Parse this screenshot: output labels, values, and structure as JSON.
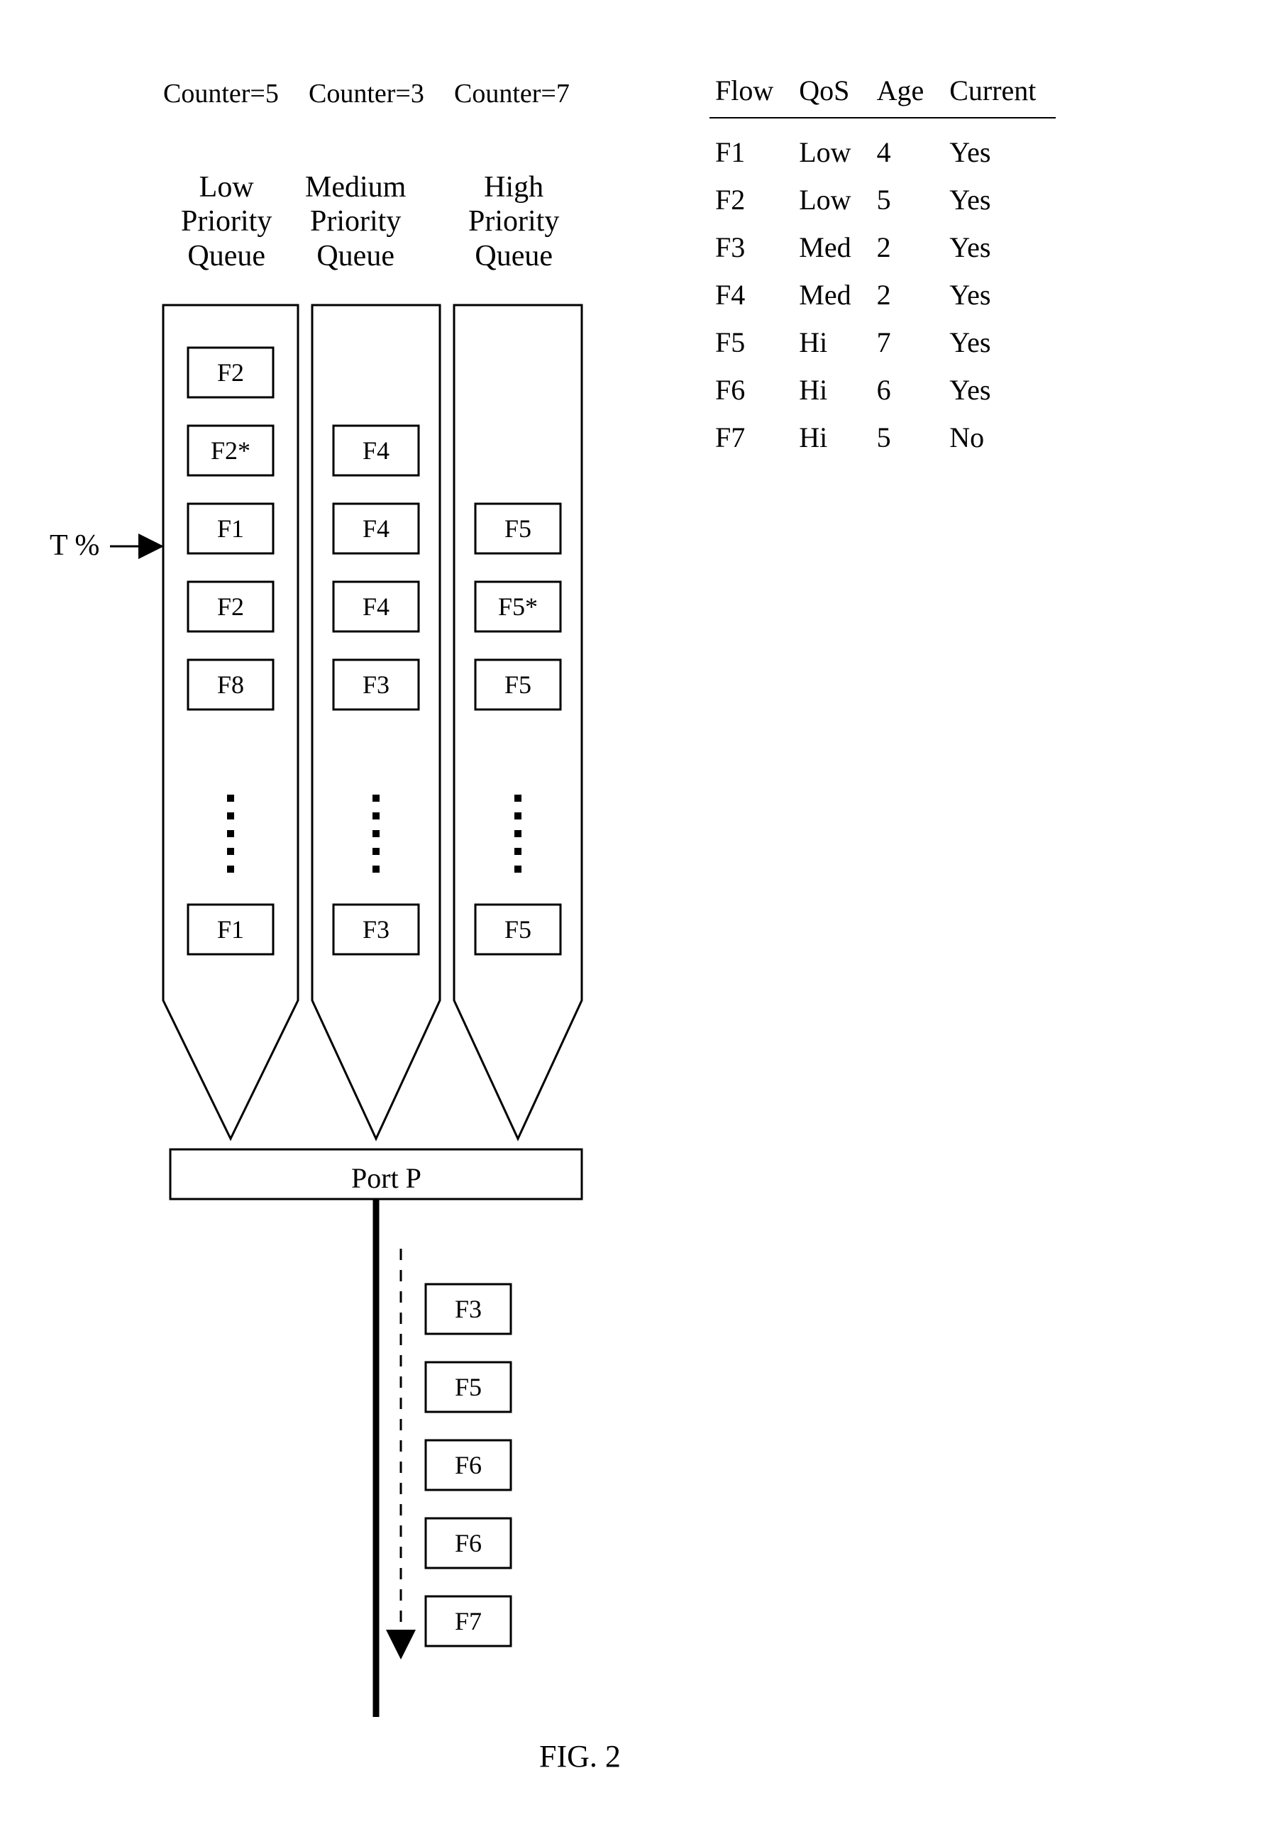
{
  "counters": {
    "low": "Counter=5",
    "med": "Counter=3",
    "high": "Counter=7"
  },
  "queue_titles": {
    "low": {
      "l1": "Low",
      "l2": "Priority",
      "l3": "Queue"
    },
    "med": {
      "l1": "Medium",
      "l2": "Priority",
      "l3": "Queue"
    },
    "high": {
      "l1": "High",
      "l2": "Priority",
      "l3": "Queue"
    }
  },
  "t_label": "T %",
  "port_label": "Port P",
  "fig_label": "FIG. 2",
  "queues": {
    "low": [
      "F2",
      "F2*",
      "F1",
      "F2",
      "F8"
    ],
    "med": [
      "",
      "F4",
      "F4",
      "F4",
      "F3"
    ],
    "high": [
      "",
      "",
      "F5",
      "F5*",
      "F5"
    ]
  },
  "queue_bottom": {
    "low": "F1",
    "med": "F3",
    "high": "F5"
  },
  "output": [
    "F3",
    "F5",
    "F6",
    "F6",
    "F7"
  ],
  "table": {
    "headers": [
      "Flow",
      "QoS",
      "Age",
      "Current"
    ],
    "rows": [
      {
        "flow": "F1",
        "qos": "Low",
        "age": "4",
        "current": "Yes"
      },
      {
        "flow": "F2",
        "qos": "Low",
        "age": "5",
        "current": "Yes"
      },
      {
        "flow": "F3",
        "qos": "Med",
        "age": "2",
        "current": "Yes"
      },
      {
        "flow": "F4",
        "qos": "Med",
        "age": "2",
        "current": "Yes"
      },
      {
        "flow": "F5",
        "qos": "Hi",
        "age": "7",
        "current": "Yes"
      },
      {
        "flow": "F6",
        "qos": "Hi",
        "age": "6",
        "current": "Yes"
      },
      {
        "flow": "F7",
        "qos": "Hi",
        "age": "5",
        "current": "No"
      }
    ]
  },
  "chart_data": {
    "type": "table",
    "title": "Priority queues with flow table and output port sequence",
    "counters": {
      "low": 5,
      "medium": 3,
      "high": 7
    },
    "threshold_marker": "T %",
    "queues": {
      "low_priority": {
        "packets_top_to_bottom": [
          "F2",
          "F2*",
          "F1",
          "F2",
          "F8",
          "...",
          "F1"
        ]
      },
      "medium_priority": {
        "packets_top_to_bottom": [
          "F4",
          "F4",
          "F4",
          "F3",
          "...",
          "F3"
        ]
      },
      "high_priority": {
        "packets_top_to_bottom": [
          "F5",
          "F5*",
          "F5",
          "...",
          "F5"
        ]
      }
    },
    "port": "Port P",
    "output_sequence_top_to_bottom": [
      "F3",
      "F5",
      "F6",
      "F6",
      "F7"
    ],
    "flow_table": {
      "columns": [
        "Flow",
        "QoS",
        "Age",
        "Current"
      ],
      "rows": [
        [
          "F1",
          "Low",
          4,
          "Yes"
        ],
        [
          "F2",
          "Low",
          5,
          "Yes"
        ],
        [
          "F3",
          "Med",
          2,
          "Yes"
        ],
        [
          "F4",
          "Med",
          2,
          "Yes"
        ],
        [
          "F5",
          "Hi",
          7,
          "Yes"
        ],
        [
          "F6",
          "Hi",
          6,
          "Yes"
        ],
        [
          "F7",
          "Hi",
          5,
          "No"
        ]
      ]
    }
  }
}
